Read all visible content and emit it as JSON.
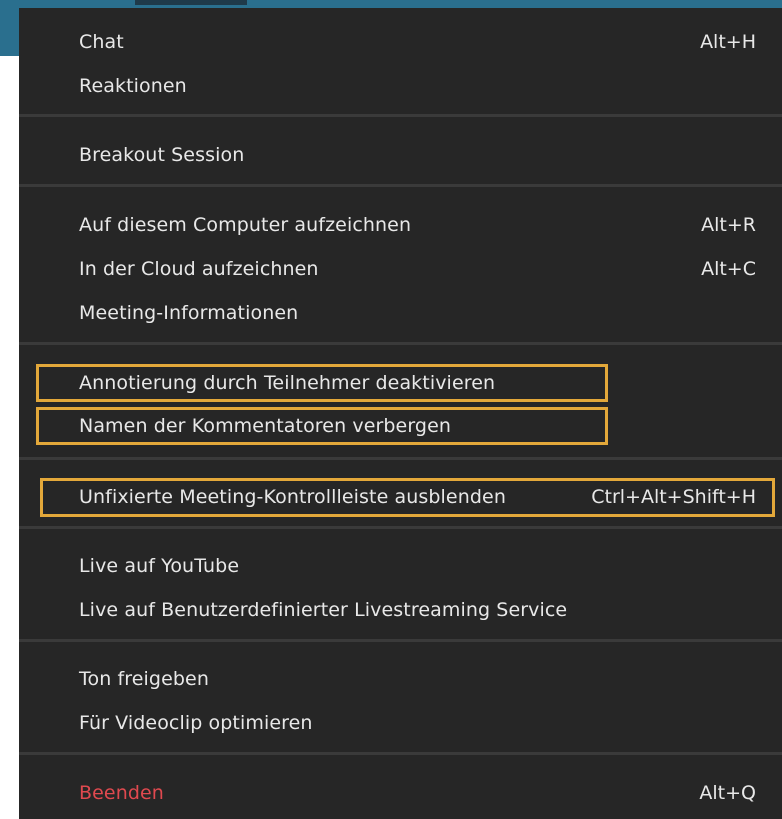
{
  "menu": {
    "items": {
      "chat": {
        "label": "Chat",
        "shortcut": "Alt+H"
      },
      "reactions": {
        "label": "Reaktionen"
      },
      "breakout": {
        "label": "Breakout Session"
      },
      "record_local": {
        "label": "Auf diesem Computer aufzeichnen",
        "shortcut": "Alt+R"
      },
      "record_cloud": {
        "label": "In der Cloud aufzeichnen",
        "shortcut": "Alt+C"
      },
      "meeting_info": {
        "label": "Meeting-Informationen"
      },
      "disable_annotation": {
        "label": "Annotierung durch Teilnehmer deaktivieren"
      },
      "hide_annotator_names": {
        "label": "Namen der Kommentatoren verbergen"
      },
      "hide_controls": {
        "label": "Unfixierte Meeting-Kontrollleiste ausblenden",
        "shortcut": "Ctrl+Alt+Shift+H"
      },
      "live_youtube": {
        "label": "Live auf YouTube"
      },
      "live_custom": {
        "label": "Live auf Benutzerdefinierter Livestreaming Service"
      },
      "share_sound": {
        "label": "Ton freigeben"
      },
      "optimize_video": {
        "label": "Für Videoclip optimieren"
      },
      "end": {
        "label": "Beenden",
        "shortcut": "Alt+Q"
      }
    }
  },
  "colors": {
    "menu_bg": "#262626",
    "text": "#e8e8e8",
    "highlight_border": "#e3a83a",
    "danger": "#e0494f",
    "window_strip": "#2a6f8e"
  }
}
